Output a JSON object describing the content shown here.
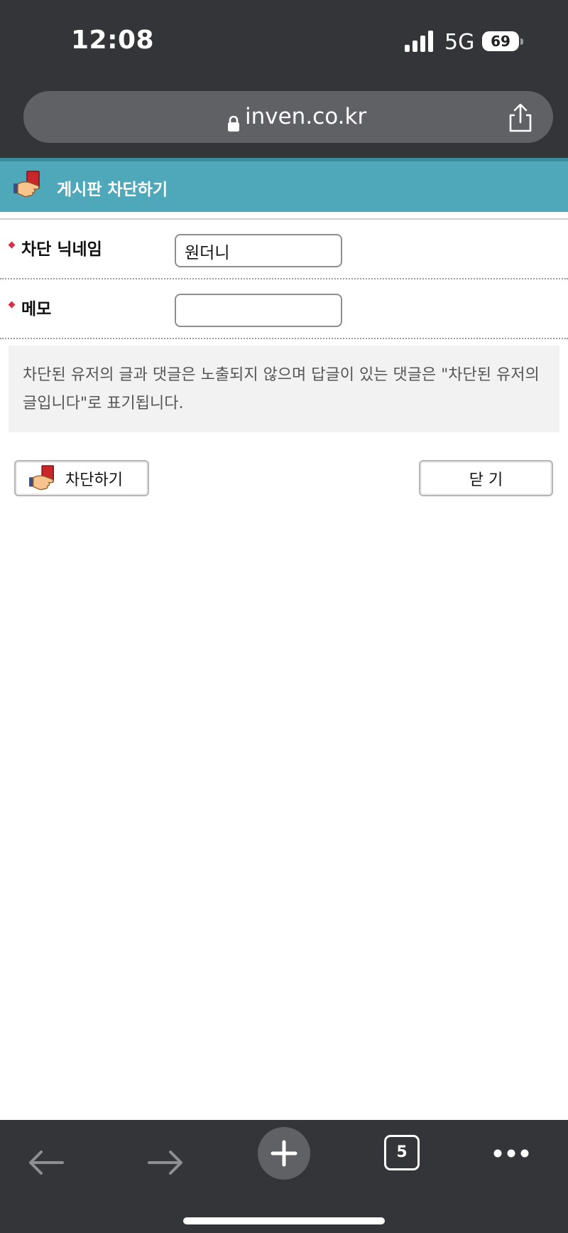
{
  "status_bar": {
    "time": "12:08",
    "network": "5G",
    "battery": "69",
    "icons": [
      "signal-icon"
    ]
  },
  "browser": {
    "url": "inven.co.kr",
    "icons": [
      "lock-icon",
      "share-icon"
    ]
  },
  "header": {
    "title": "게시판 차단하기",
    "icon": "red-card-hand-icon",
    "color": "#4ea8b9"
  },
  "form": {
    "nickname_label": "차단 닉네임",
    "nickname_value": "원더니",
    "memo_label": "메모",
    "memo_value": "",
    "bullet_color": "#d3304a"
  },
  "notice": {
    "text": "차단된 유저의 글과 댓글은 노출되지 않으며 답글이 있는 댓글은 \"차단된 유저의 글입니다\"로 표기됩니다."
  },
  "buttons": {
    "block_label": "차단하기",
    "close_label": "닫 기"
  },
  "toolbar": {
    "tab_count": "5",
    "icons": [
      "back-arrow-icon",
      "forward-arrow-icon",
      "plus-icon",
      "tabs-icon",
      "more-icon"
    ]
  }
}
